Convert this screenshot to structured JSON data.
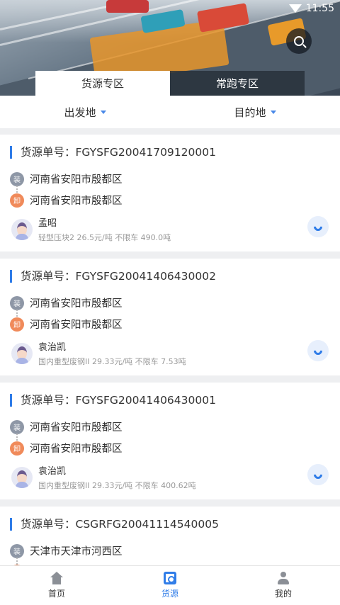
{
  "status_bar": {
    "time": "11:55"
  },
  "tabs": [
    {
      "label": "货源专区",
      "active": true
    },
    {
      "label": "常跑专区",
      "active": false
    }
  ],
  "filters": {
    "origin": "出发地",
    "destination": "目的地"
  },
  "id_prefix": "货源单号：",
  "load_badge": "装",
  "unload_badge": "卸",
  "cards": [
    {
      "id": "FGYSFG20041709120001",
      "load": "河南省安阳市殷都区",
      "unload": "河南省安阳市殷都区",
      "name": "孟昭",
      "desc": "轻型压块2 26.5元/吨 不限车 490.0吨"
    },
    {
      "id": "FGYSFG20041406430002",
      "load": "河南省安阳市殷都区",
      "unload": "河南省安阳市殷都区",
      "name": "袁治凯",
      "desc": "国内重型废钢II 29.33元/吨 不限车 7.53吨"
    },
    {
      "id": "FGYSFG20041406430001",
      "load": "河南省安阳市殷都区",
      "unload": "河南省安阳市殷都区",
      "name": "袁治凯",
      "desc": "国内重型废钢II 29.33元/吨 不限车 400.62吨"
    },
    {
      "id": "CSGRFG20041114540005",
      "load": "天津市天津市河西区"
    }
  ],
  "nav": [
    {
      "label": "首页",
      "active": false,
      "icon": "home-icon"
    },
    {
      "label": "货源",
      "active": true,
      "icon": "cargo-icon"
    },
    {
      "label": "我的",
      "active": false,
      "icon": "profile-icon"
    }
  ],
  "colors": {
    "accent": "#2f7ce8",
    "unload": "#f08a5a",
    "load": "#8e97a6"
  }
}
